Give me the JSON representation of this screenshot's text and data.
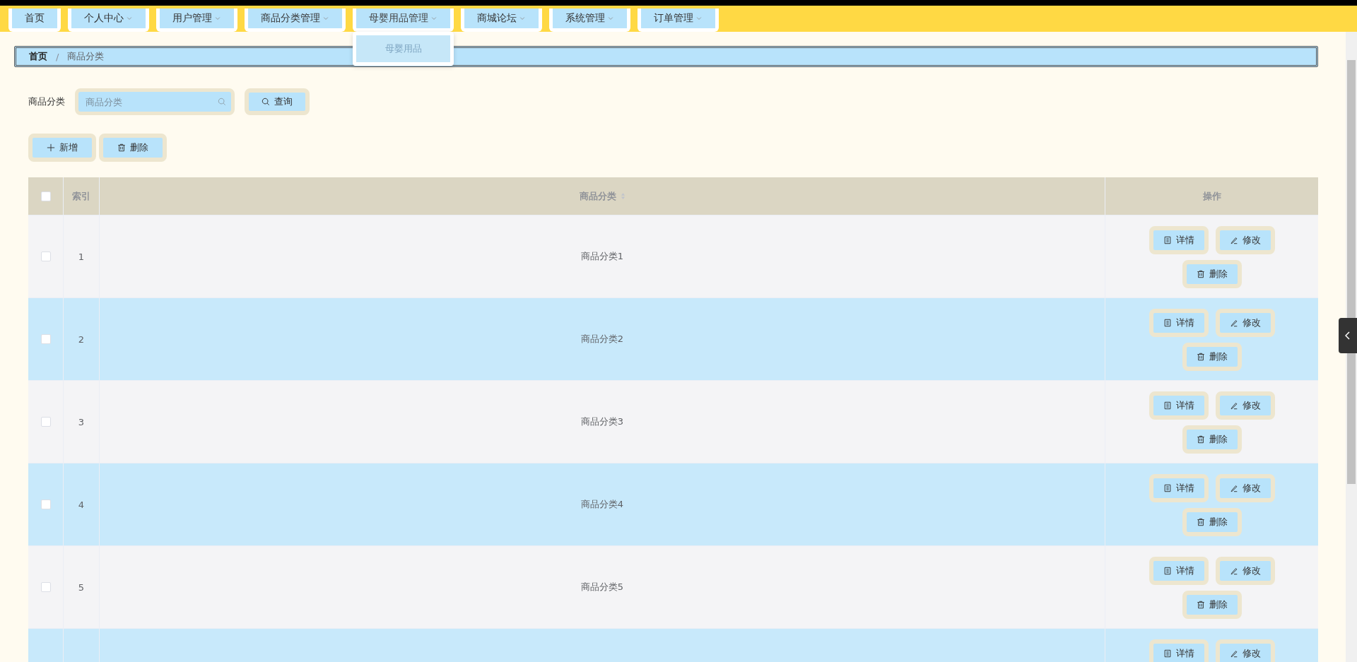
{
  "nav": {
    "items": [
      {
        "label": "首页",
        "has_caret": false,
        "expanded": false
      },
      {
        "label": "个人中心",
        "has_caret": true,
        "expanded": false
      },
      {
        "label": "用户管理",
        "has_caret": true,
        "expanded": false
      },
      {
        "label": "商品分类管理",
        "has_caret": true,
        "expanded": false
      },
      {
        "label": "母婴用品管理",
        "has_caret": true,
        "expanded": true,
        "submenu": [
          "母婴用品"
        ]
      },
      {
        "label": "商城论坛",
        "has_caret": true,
        "expanded": false
      },
      {
        "label": "系统管理",
        "has_caret": true,
        "expanded": false
      },
      {
        "label": "订单管理",
        "has_caret": true,
        "expanded": false
      }
    ]
  },
  "breadcrumb": {
    "items": [
      "首页",
      "商品分类"
    ],
    "separator": "/"
  },
  "search": {
    "label": "商品分类",
    "placeholder": "商品分类",
    "button": "查询"
  },
  "toolbar": [
    {
      "kind": "add",
      "label": "新增"
    },
    {
      "kind": "delete",
      "label": "删除"
    }
  ],
  "table": {
    "columns": [
      {
        "kind": "checkbox",
        "checked": false
      },
      {
        "kind": "index",
        "label": "索引"
      },
      {
        "kind": "text",
        "label": "商品分类",
        "sortable": true
      },
      {
        "kind": "actions",
        "label": "操作"
      }
    ],
    "rows": [
      {
        "index": "1",
        "name": "商品分类1",
        "checked": false,
        "actions": [
          {
            "kind": "detail",
            "label": "详情"
          },
          {
            "kind": "edit",
            "label": "修改"
          },
          {
            "kind": "delete",
            "label": "删除"
          }
        ]
      },
      {
        "index": "2",
        "name": "商品分类2",
        "checked": false,
        "actions": [
          {
            "kind": "detail",
            "label": "详情"
          },
          {
            "kind": "edit",
            "label": "修改"
          },
          {
            "kind": "delete",
            "label": "删除"
          }
        ]
      },
      {
        "index": "3",
        "name": "商品分类3",
        "checked": false,
        "actions": [
          {
            "kind": "detail",
            "label": "详情"
          },
          {
            "kind": "edit",
            "label": "修改"
          },
          {
            "kind": "delete",
            "label": "删除"
          }
        ]
      },
      {
        "index": "4",
        "name": "商品分类4",
        "checked": false,
        "actions": [
          {
            "kind": "detail",
            "label": "详情"
          },
          {
            "kind": "edit",
            "label": "修改"
          },
          {
            "kind": "delete",
            "label": "删除"
          }
        ]
      },
      {
        "index": "5",
        "name": "商品分类5",
        "checked": false,
        "actions": [
          {
            "kind": "detail",
            "label": "详情"
          },
          {
            "kind": "edit",
            "label": "修改"
          },
          {
            "kind": "delete",
            "label": "删除"
          }
        ]
      },
      {
        "actions": [
          {
            "kind": "detail",
            "label": "详情"
          },
          {
            "kind": "edit",
            "label": "修改"
          }
        ]
      }
    ]
  }
}
